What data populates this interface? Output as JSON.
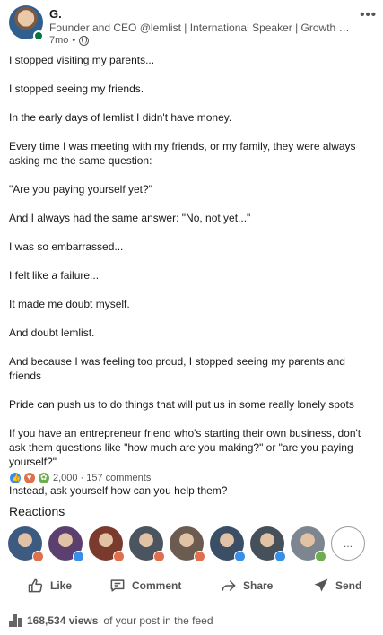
{
  "author": {
    "name": "G.",
    "headline": "Founder and CEO @lemlist | International Speaker | Growth Expert | Hiring",
    "time": "7mo",
    "separator": "•"
  },
  "post": {
    "paragraphs": [
      "I stopped visiting my parents...",
      "I stopped seeing my friends.",
      "In the early days of lemlist I didn't have money.",
      "Every time I was meeting with my friends, or my family, they were always asking me the same question:",
      "\"Are you paying yourself yet?\"",
      "And I always had the same answer: \"No, not yet...\"",
      "I was so embarrassed...",
      "I felt like a failure...",
      "It made me doubt myself.",
      "And doubt lemlist.",
      "And because I was feeling too proud, I stopped seeing my parents and friends",
      "Pride can push us to do things that will put us in some really lonely spots",
      "If you have an entrepreneur friend who's starting their own business, don't ask them questions like \"how much are you making?\" or \"are you paying yourself?\"",
      "Instead, ask yourself how can you help them?"
    ]
  },
  "social": {
    "reactions_count": "2,000",
    "dot": "·",
    "comments": "157 comments",
    "reaction_icons": [
      "like-icon",
      "love-icon",
      "support-icon"
    ]
  },
  "reactions": {
    "title": "Reactions",
    "more_label": "...",
    "people": [
      {
        "badge": "love",
        "color": "#3d5a80"
      },
      {
        "badge": "like",
        "color": "#5b3f6e"
      },
      {
        "badge": "love",
        "color": "#7a3a2e"
      },
      {
        "badge": "love",
        "color": "#4a5560"
      },
      {
        "badge": "love",
        "color": "#6b5b50"
      },
      {
        "badge": "like",
        "color": "#3a4e66"
      },
      {
        "badge": "like",
        "color": "#46505a"
      },
      {
        "badge": "support",
        "color": "#7d8590"
      }
    ]
  },
  "actions": {
    "like": "Like",
    "comment": "Comment",
    "share": "Share",
    "send": "Send"
  },
  "views": {
    "count": "168,534 views",
    "suffix": "of your post in the feed"
  },
  "colors": {
    "like": "#378fe9",
    "love": "#df704d",
    "support": "#6dae4f",
    "online": "#057642"
  }
}
